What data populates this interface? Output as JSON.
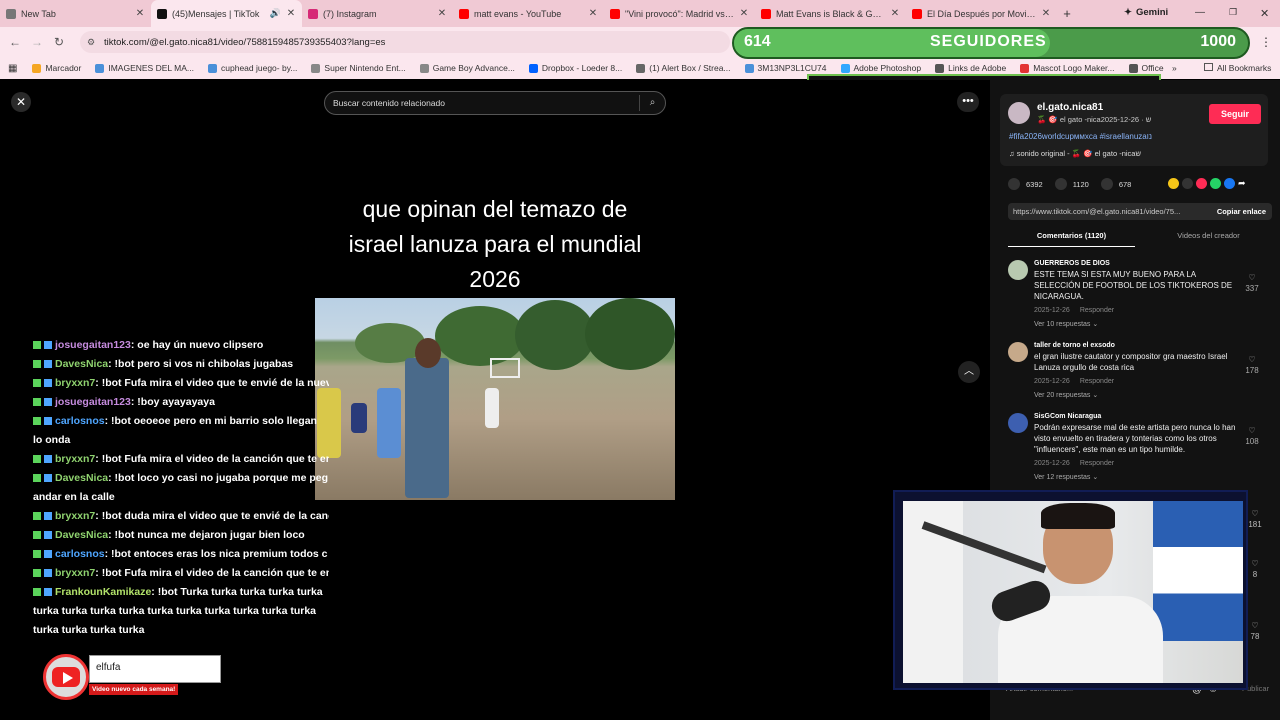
{
  "tabs": [
    {
      "title": "New Tab",
      "icon": "chrome-icon",
      "color": "#777777"
    },
    {
      "title": "(45)Mensajes | TikTok",
      "icon": "tiktok-icon",
      "color": "#111111",
      "active": true
    },
    {
      "title": "(7) Instagram",
      "icon": "instagram-icon",
      "color": "#d62976"
    },
    {
      "title": "matt evans - YouTube",
      "icon": "youtube-icon",
      "color": "#ff0000"
    },
    {
      "title": "\"Vini provocó\": Madrid vs Ch",
      "icon": "youtube-icon",
      "color": "#ff0000"
    },
    {
      "title": "Matt Evans is Black & Gold -",
      "icon": "youtube-icon",
      "color": "#ff0000"
    },
    {
      "title": "El Día Después por Movistar",
      "icon": "youtube-icon",
      "color": "#ff0000"
    }
  ],
  "gemini_label": "Gemini",
  "url": "tiktok.com/@el.gato.nica81/video/7588159485739355403?lang=es",
  "bookmarks": [
    {
      "label": "Marcador",
      "color": "#f5a623"
    },
    {
      "label": "IMAGENES DEL MA...",
      "color": "#4a90d9"
    },
    {
      "label": "cuphead juego- by...",
      "color": "#4a90d9"
    },
    {
      "label": "Super Nintendo Ent...",
      "color": "#888888"
    },
    {
      "label": "Game Boy Advance...",
      "color": "#888888"
    },
    {
      "label": "Dropbox - Loeder 8...",
      "color": "#0061ff"
    },
    {
      "label": "(1) Alert Box / Strea...",
      "color": "#666666"
    },
    {
      "label": "3M13NP3L1CU74",
      "color": "#4a90d9"
    },
    {
      "label": "Adobe Photoshop",
      "color": "#31a8ff"
    },
    {
      "label": "Links de Adobe",
      "color": "#555555"
    },
    {
      "label": "Mascot Logo Maker...",
      "color": "#e33333"
    },
    {
      "label": "Office",
      "color": "#555555"
    }
  ],
  "all_bookmarks": "All Bookmarks",
  "followers": {
    "current": "614",
    "label": "SEGUIDORES",
    "goal": "1000",
    "progress": 0.614
  },
  "search_placeholder": "Buscar contenido relacionado",
  "video_caption": [
    "que opinan del temazo de",
    "israel lanuza para el mundial",
    "2026"
  ],
  "chat": [
    {
      "user": "josuegaitan123",
      "msg": ": oe hay ún nuevo clipsero",
      "cls": "u1"
    },
    {
      "user": "DavesNica",
      "msg": ": !bot pero si vos ni chibolas jugabas",
      "cls": "u3"
    },
    {
      "user": "bryxxn7",
      "msg": ": !bot Fufa mira el video que te envié de la nueva",
      "cls": "u3"
    },
    {
      "user": "josuegaitan123",
      "msg": ": !boy ayayayaya",
      "cls": "u1"
    },
    {
      "user": "carlosnos",
      "msg": ": !bot oeoeoe pero en mi barrio solo llegan lo onda",
      "cls": "u4",
      "wrap": true
    },
    {
      "user": "bryxxn7",
      "msg": ": !bot Fufa mira el video de la canción que te envi",
      "cls": "u3"
    },
    {
      "user": "DavesNica",
      "msg": ": !bot loco yo casi no jugaba porque me peg andar en la calle",
      "cls": "u3",
      "wrap": true
    },
    {
      "user": "bryxxn7",
      "msg": ": !bot duda mira el video que te envié de la canci",
      "cls": "u3"
    },
    {
      "user": "DavesNica",
      "msg": ": !bot nunca me dejaron jugar bien loco",
      "cls": "u3"
    },
    {
      "user": "carlosnos",
      "msg": ": !bot entoces eras los nica premium todos c",
      "cls": "u4"
    },
    {
      "user": "bryxxn7",
      "msg": ": !bot Fufa mira el video de la canción que te envi",
      "cls": "u3"
    },
    {
      "user": "FrankounKamikaze",
      "msg": ": !bot Turka turka turka turka turka turka turka turka turka turka turka turka turka turka turka turka turka turka turka",
      "cls": "u2",
      "wrap": true
    }
  ],
  "youtube_overlay": {
    "name": "elfufa",
    "tagline": "Video nuevo cada semana!"
  },
  "author": {
    "username": "el.gato.nica81",
    "display": "🍒 🎯 el gato -nicaש · 2025-12-26",
    "follow": "Seguir",
    "hashtags": "#fifa2026worldcupммxса #israellanuzaנו",
    "sound": "sonido original - 🍒 🎯 el gato -nicaש"
  },
  "stats": {
    "likes": "6392",
    "comments": "1120",
    "saves": "678"
  },
  "link_text": "https://www.tiktok.com/@el.gato.nica81/video/75...",
  "copy_link": "Copiar enlace",
  "tab_comments": "Comentarios (1120)",
  "tab_creator": "Videos del creador",
  "comments": [
    {
      "name": "GUERREROS DE DIOS",
      "text": "ESTE TEMA SI ESTA MUY BUENO PARA LA SELECCIÓN DE FOOTBOL DE LOS TIKTOKEROS DE NICARAGUA.",
      "date": "2025-12-26",
      "reply": "Responder",
      "replies": "Ver 10 respuestas ⌄",
      "likes": "337"
    },
    {
      "name": "taller de torno el exsodo",
      "text": "el gran ilustre cautator y compositor gra maestro Israel Lanuza orgullo de costa rica",
      "date": "2025-12-26",
      "reply": "Responder",
      "replies": "Ver 20 respuestas ⌄",
      "likes": "178"
    },
    {
      "name": "SisGCom Nicaragua",
      "text": "Podrán expresarse mal de este artista pero nunca lo han visto envuelto en tiradera y tonterias como los otros \"influencers\", este man es un tipo humilde.",
      "date": "2025-12-26",
      "reply": "Responder",
      "replies": "Ver 12 respuestas ⌄",
      "likes": "108"
    }
  ],
  "side_likes": [
    "181",
    "8",
    "78"
  ],
  "add_comment": "Añadir comentario...",
  "publish": "Publicar"
}
